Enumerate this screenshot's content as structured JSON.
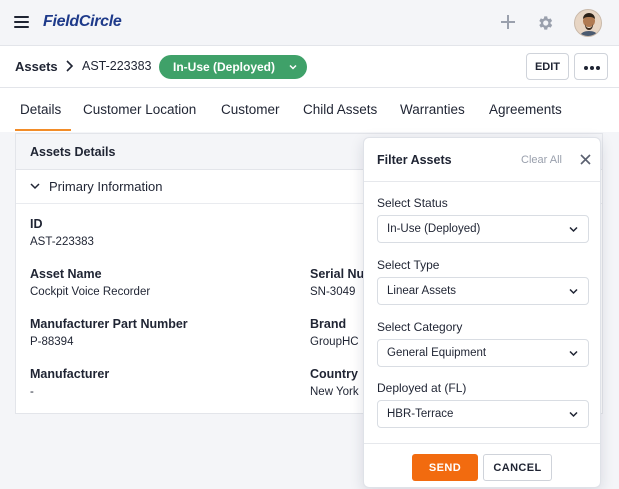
{
  "header": {
    "logo": "FieldCircle",
    "icons": [
      "menu-icon",
      "plus-icon",
      "gear-icon",
      "avatar"
    ]
  },
  "breadcrumb": {
    "root": "Assets",
    "current": "AST-223383",
    "status": "In-Use (Deployed)",
    "edit_label": "EDIT"
  },
  "tabs": [
    {
      "label": "Details",
      "active": true
    },
    {
      "label": "Customer Location"
    },
    {
      "label": "Customer"
    },
    {
      "label": "Child Assets"
    },
    {
      "label": "Warranties"
    },
    {
      "label": "Agreements"
    }
  ],
  "card": {
    "title": "Assets Details",
    "section": "Primary Information",
    "fields": {
      "id_label": "ID",
      "id_value": "AST-223383",
      "asset_name_label": "Asset Name",
      "asset_name_value": "Cockpit Voice Recorder",
      "serial_label": "Serial Nu",
      "serial_value": "SN-3049",
      "mpn_label": "Manufacturer Part Number",
      "mpn_value": "P-88394",
      "brand_label": "Brand",
      "brand_value": "GroupHC",
      "manufacturer_label": "Manufacturer",
      "manufacturer_value": "-",
      "country_label": "Country",
      "country_value": "New York"
    }
  },
  "filter": {
    "title": "Filter Assets",
    "clear_all": "Clear All",
    "status_label": "Select Status",
    "status_value": "In-Use (Deployed)",
    "type_label": "Select Type",
    "type_value": "Linear Assets",
    "category_label": "Select Category",
    "category_value": "General Equipment",
    "deployed_label": "Deployed at (FL)",
    "deployed_value": "HBR-Terrace",
    "send_label": "SEND",
    "cancel_label": "CANCEL"
  },
  "colors": {
    "brand": "#1e3a8a",
    "status_green": "#3fa169",
    "accent_orange": "#f26b0f",
    "tab_underline": "#f28c28"
  }
}
